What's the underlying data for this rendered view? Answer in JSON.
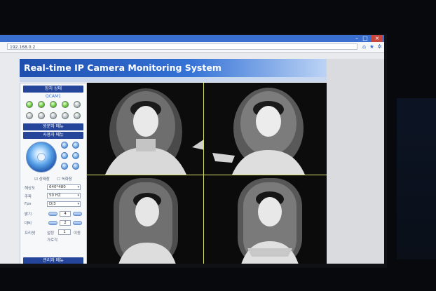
{
  "browser": {
    "address": "192.168.0.2",
    "controls": [
      "–",
      "□",
      "×"
    ]
  },
  "page_title": "Real-time IP Camera Monitoring System",
  "sidebar": {
    "device_status_label": "장치 상태",
    "device_model": "QCAM1",
    "visitor_menu_label": "방문자 메뉴",
    "user_menu_label": "사용자 메뉴",
    "checkbox_1_label": "상태창",
    "checkbox_2_label": "녹화창",
    "resolution": {
      "label": "해상도",
      "value": "640*480"
    },
    "frequency": {
      "label": "주파",
      "value": "50 HZ"
    },
    "fps": {
      "label": "Fps",
      "value": "D/3"
    },
    "brightness": {
      "label": "밝기",
      "value": "4"
    },
    "contrast": {
      "label": "대비",
      "value": "2"
    },
    "preset": {
      "label": "프리셋",
      "set_label": "설정",
      "set_value": "1",
      "goto_label": "이동",
      "sub_label": "가로각"
    },
    "admin_menu_label": "관리자 메뉴"
  },
  "status_leds": {
    "row1": [
      "on",
      "on",
      "on",
      "on",
      "off"
    ],
    "row2": [
      "off",
      "off",
      "off",
      "off",
      "off"
    ]
  },
  "colors": {
    "header": "#1e4fae",
    "section_bar": "#24459a",
    "grid_divider": "#d8e06a"
  }
}
